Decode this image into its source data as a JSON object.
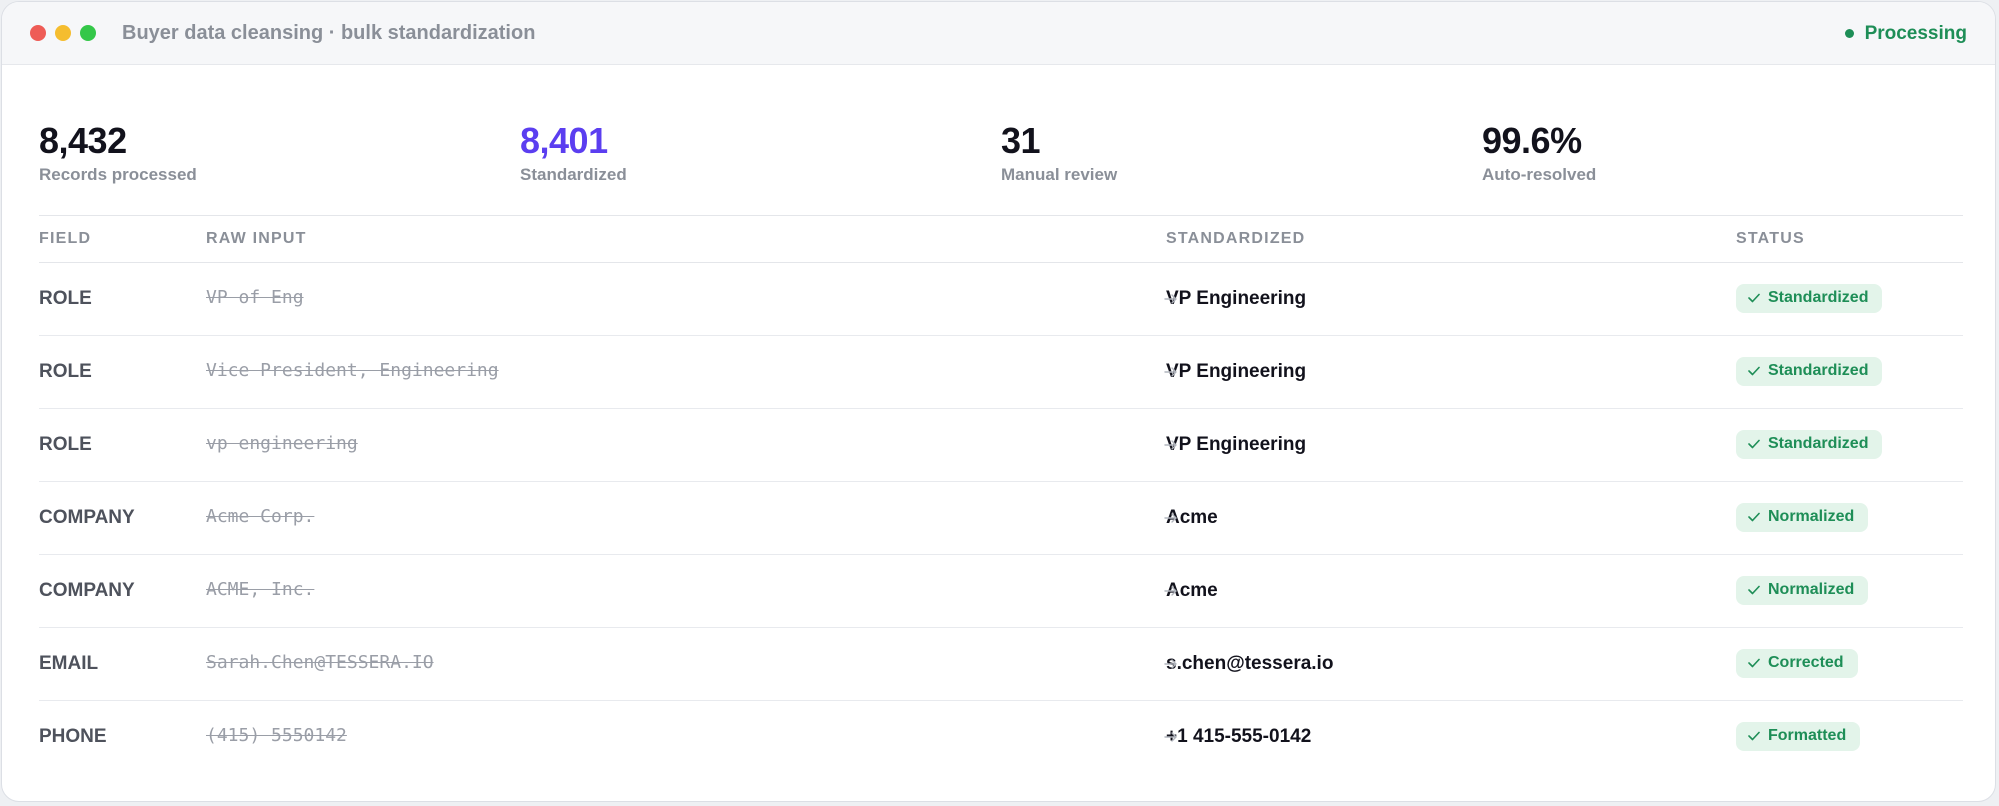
{
  "window": {
    "title": "Buyer data cleansing · bulk standardization",
    "status": "Processing",
    "status_color": "#1e8e57"
  },
  "stats": [
    {
      "value": "8,432",
      "label": "Records processed",
      "color": "#12121c"
    },
    {
      "value": "8,401",
      "label": "Standardized",
      "color": "#5b3ef0"
    },
    {
      "value": "31",
      "label": "Manual review",
      "color": "#12121c"
    },
    {
      "value": "99.6%",
      "label": "Auto-resolved",
      "color": "#12121c"
    }
  ],
  "table": {
    "headers": {
      "field": "FIELD",
      "raw": "RAW INPUT",
      "standardized": "STANDARDIZED",
      "status": "STATUS"
    },
    "rows": [
      {
        "field": "ROLE",
        "raw": "VP of Eng",
        "standardized": "VP Engineering",
        "status": "Standardized"
      },
      {
        "field": "ROLE",
        "raw": "Vice President, Engineering",
        "standardized": "VP Engineering",
        "status": "Standardized"
      },
      {
        "field": "ROLE",
        "raw": "vp engineering",
        "standardized": "VP Engineering",
        "status": "Standardized"
      },
      {
        "field": "COMPANY",
        "raw": "Acme Corp.",
        "standardized": "Acme",
        "status": "Normalized"
      },
      {
        "field": "COMPANY",
        "raw": "ACME, Inc.",
        "standardized": "Acme",
        "status": "Normalized"
      },
      {
        "field": "EMAIL",
        "raw": "Sarah.Chen@TESSERA.IO",
        "standardized": "s.chen@tessera.io",
        "status": "Corrected"
      },
      {
        "field": "PHONE",
        "raw": "(415) 5550142",
        "standardized": "+1 415-555-0142",
        "status": "Formatted"
      }
    ]
  },
  "icons": {
    "arrow": "arrow-right-icon",
    "check": "check-icon"
  },
  "colors": {
    "accent": "#5b3ef0",
    "success": "#1e8e57",
    "success_bg": "#e3f4ea"
  }
}
